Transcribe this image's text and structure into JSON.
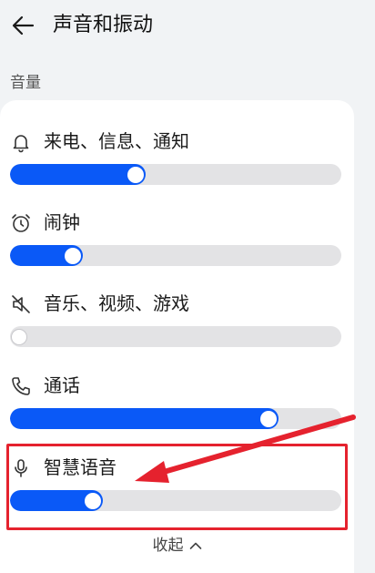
{
  "header": {
    "title": "声音和振动",
    "back_icon": "arrow-left-icon"
  },
  "section": {
    "label": "音量"
  },
  "volume_items": [
    {
      "label": "来电、信息、通知",
      "icon": "bell-icon",
      "level_percent": 41
    },
    {
      "label": "闹钟",
      "icon": "alarm-clock-icon",
      "level_percent": 22
    },
    {
      "label": "音乐、视频、游戏",
      "icon": "speaker-muted-icon",
      "level_percent": 0
    },
    {
      "label": "通话",
      "icon": "phone-icon",
      "level_percent": 81
    },
    {
      "label": "智慧语音",
      "icon": "microphone-icon",
      "level_percent": 28
    }
  ],
  "footer": {
    "collapse_label": "收起"
  },
  "colors": {
    "accent": "#0a59f7",
    "annotation": "#e5222e",
    "track": "#e3e3e5"
  }
}
